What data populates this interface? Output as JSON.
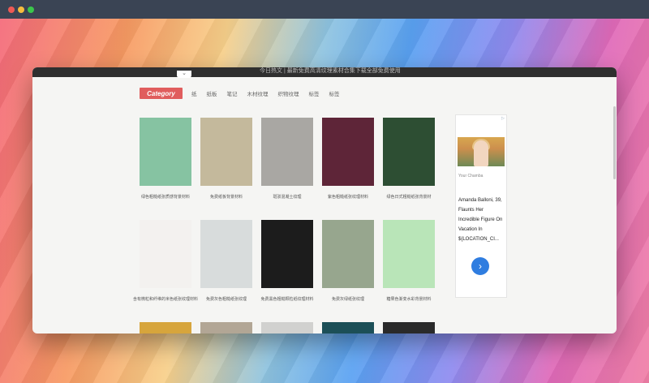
{
  "window": {
    "marquee": "今日热文 | 最新免费高清纹理素材合集下载全部免费使用"
  },
  "category": {
    "button": "Category",
    "links": [
      "纸",
      "纸板",
      "笔记",
      "木材纹理",
      "织物纹理",
      "标签",
      "标签"
    ]
  },
  "tiles": [
    {
      "caption": "绿色粗糙纸张质感背景材料",
      "color": "#86c3a2"
    },
    {
      "caption": "免费纸板背景材料",
      "color": "#c4b99c"
    },
    {
      "caption": "斑驳混凝土纹理",
      "color": "#a9a7a3"
    },
    {
      "caption": "紫色粗糙纸张纹理材料",
      "color": "#5e2538"
    },
    {
      "caption": "绿色日式粗糙纸张背景材",
      "color": "#2d4e33"
    },
    {
      "caption": "含有微粒和纤维的米色纸张纹理材料",
      "color": "#f3f1ef"
    },
    {
      "caption": "免费灰色粗糙纸张纹理",
      "color": "#d8dcdc"
    },
    {
      "caption": "免费黑色粗糙颗粒纸纹理材料",
      "color": "#1c1c1c"
    },
    {
      "caption": "免费灰绿纸张纹理",
      "color": "#97a68e"
    },
    {
      "caption": "糖果色渐变水彩背景材料",
      "color": "#b9e5b8"
    },
    {
      "caption": "",
      "color": "#d7a53c"
    },
    {
      "caption": "",
      "color": "#b2a695"
    },
    {
      "caption": "",
      "color": "#d1d1cf"
    },
    {
      "caption": "",
      "color": "#1c4f57"
    },
    {
      "caption": "",
      "color": "#2a2a2a"
    }
  ],
  "ad": {
    "sponsor": "Your Chamba",
    "headline": "Amanda Balloni, 39, Flaunts Her Incredible Figure On Vacation In ${LOCATION_CI...",
    "cta_icon": "chevron-right-icon"
  }
}
